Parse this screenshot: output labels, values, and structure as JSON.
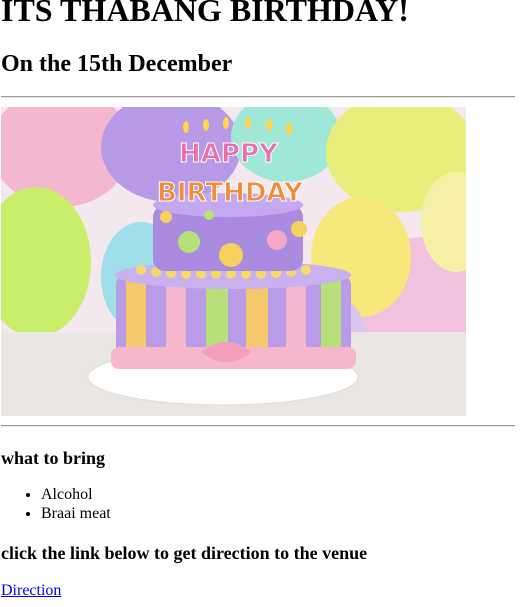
{
  "header": {
    "title": "ITS THABANG BIRTHDAY!",
    "date_line": "On the 15th December"
  },
  "image": {
    "name": "birthday-cake-image",
    "candle_text_top": "HAPPY",
    "candle_text_bottom": "BIRTHDAY"
  },
  "bring": {
    "heading": "what to bring",
    "items": [
      "Alcohol",
      "Braai meat"
    ]
  },
  "directions": {
    "heading": "click the link below to get direction to the venue",
    "link_label": "Direction"
  },
  "colors": {
    "link": "#0000ee",
    "rule": "#9a9a9a"
  }
}
